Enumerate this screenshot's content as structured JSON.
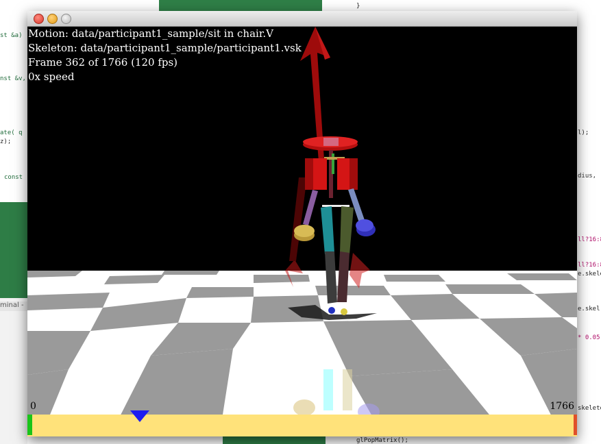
{
  "window": {
    "traffic_lights": [
      "close",
      "minimize",
      "zoom"
    ]
  },
  "overlay": {
    "motion": "Motion: data/participant1_sample/sit in chair.V",
    "skeleton": "Skeleton: data/participant1_sample/participant1.vsk",
    "frame": "Frame 362 of 1766 (120 fps)",
    "speed": "0x speed"
  },
  "timeline": {
    "start_label": "0",
    "end_label": "1766",
    "current_frame": 362,
    "total_frames": 1766,
    "bar_color": "#ffe27a",
    "marker_color": "#1c1cf0"
  },
  "background": {
    "code_fragments": [
      "}",
      "st &a)",
      "nst &v,",
      "ate( q",
      "z);",
      "const",
      "minal -",
      "l);",
      "dius,",
      "ll?16:8",
      "ll?16:8",
      "e.skele",
      "e.skel",
      "* 0.05,",
      "skeleto",
      "glPopMatrix();"
    ]
  },
  "colors": {
    "floor_light": "#ffffff",
    "floor_dark": "#9a9a9a",
    "sky": "#000000",
    "arrow": "#a31010",
    "joint_red": "#d01010"
  }
}
